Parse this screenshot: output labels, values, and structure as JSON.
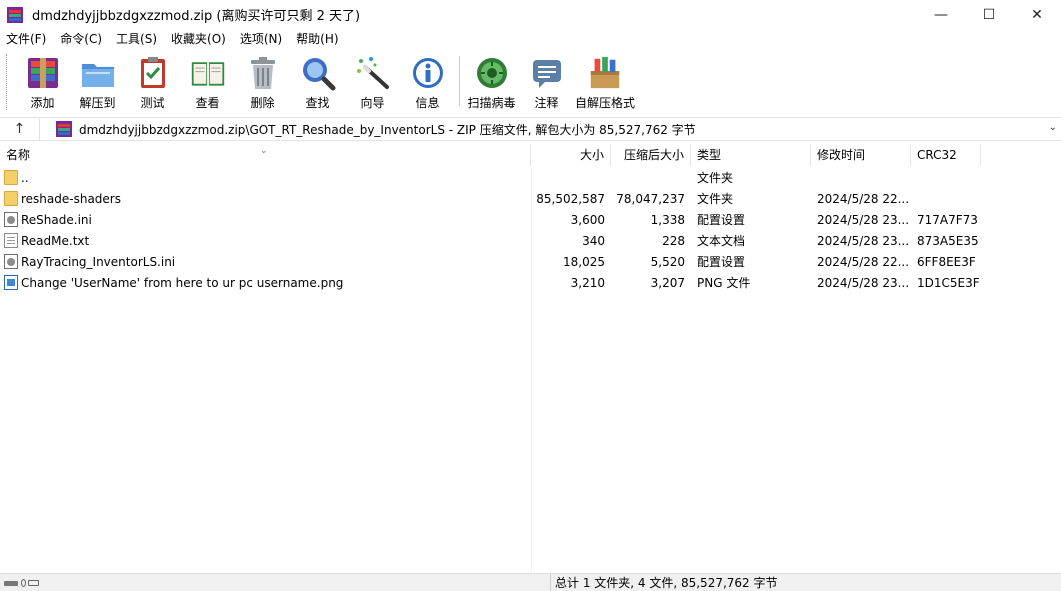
{
  "window": {
    "title": "dmdzhdyjjbbzdgxzzmod.zip (离购买许可只剩 2 天了)",
    "minimize_glyph": "—",
    "maximize_glyph": "☐",
    "close_glyph": "✕"
  },
  "menu": [
    {
      "label": "文件(F)"
    },
    {
      "label": "命令(C)"
    },
    {
      "label": "工具(S)"
    },
    {
      "label": "收藏夹(O)"
    },
    {
      "label": "选项(N)"
    },
    {
      "label": "帮助(H)"
    }
  ],
  "toolbar": [
    {
      "label": "添加",
      "icon": "add-archive-icon"
    },
    {
      "label": "解压到",
      "icon": "extract-to-icon"
    },
    {
      "label": "测试",
      "icon": "test-icon"
    },
    {
      "label": "查看",
      "icon": "view-book-icon"
    },
    {
      "label": "删除",
      "icon": "trash-icon"
    },
    {
      "label": "查找",
      "icon": "find-magnifier-icon"
    },
    {
      "label": "向导",
      "icon": "wizard-wand-icon"
    },
    {
      "label": "信息",
      "icon": "info-icon"
    },
    {
      "label": "扫描病毒",
      "icon": "virus-scan-icon"
    },
    {
      "label": "注释",
      "icon": "comment-icon"
    },
    {
      "label": "自解压格式",
      "icon": "sfx-box-icon"
    }
  ],
  "address": {
    "up_glyph": "↑",
    "path": "dmdzhdyjjbbzdgxzzmod.zip\\GOT_RT_Reshade_by_InventorLS - ZIP 压缩文件, 解包大小为 85,527,762 字节",
    "dropdown_glyph": "⌄"
  },
  "columns": {
    "name": "名称",
    "size": "大小",
    "packed": "压缩后大小",
    "type": "类型",
    "modified": "修改时间",
    "crc": "CRC32",
    "sort_glyph": "⌄"
  },
  "files": [
    {
      "name": "..",
      "size": "",
      "packed": "",
      "type": "文件夹",
      "modified": "",
      "crc": "",
      "icon": "folder"
    },
    {
      "name": "reshade-shaders",
      "size": "85,502,587",
      "packed": "78,047,237",
      "type": "文件夹",
      "modified": "2024/5/28 22...",
      "crc": "",
      "icon": "folder"
    },
    {
      "name": "ReShade.ini",
      "size": "3,600",
      "packed": "1,338",
      "type": "配置设置",
      "modified": "2024/5/28 23...",
      "crc": "717A7F73",
      "icon": "ini"
    },
    {
      "name": "ReadMe.txt",
      "size": "340",
      "packed": "228",
      "type": "文本文档",
      "modified": "2024/5/28 23...",
      "crc": "873A5E35",
      "icon": "doc"
    },
    {
      "name": "RayTracing_InventorLS.ini",
      "size": "18,025",
      "packed": "5,520",
      "type": "配置设置",
      "modified": "2024/5/28 22...",
      "crc": "6FF8EE3F",
      "icon": "ini"
    },
    {
      "name": "Change 'UserName' from here to ur pc username.png",
      "size": "3,210",
      "packed": "3,207",
      "type": "PNG 文件",
      "modified": "2024/5/28 23...",
      "crc": "1D1C5E3F",
      "icon": "img"
    }
  ],
  "status": {
    "summary": "总计 1 文件夹, 4 文件, 85,527,762 字节"
  },
  "colors": {
    "window_bg": "#ffffff",
    "status_bg": "#f0f0f0",
    "folder": "#f5cf6b"
  }
}
